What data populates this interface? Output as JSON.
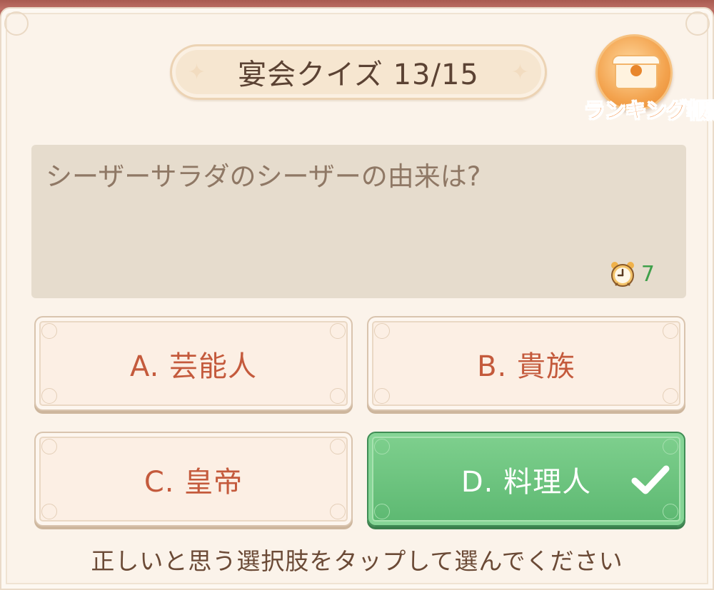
{
  "header": {
    "title": "宴会クイズ 13/15"
  },
  "ranking": {
    "label": "ランキング報酬",
    "icon": "treasure-chest-icon"
  },
  "question": {
    "text": "シーザーサラダのシーザーの由来は?",
    "timer_icon": "alarm-clock-icon",
    "timer_value": "7"
  },
  "options": [
    {
      "label": "A. 芸能人",
      "selected": false
    },
    {
      "label": "B. 貴族",
      "selected": false
    },
    {
      "label": "C. 皇帝",
      "selected": false
    },
    {
      "label": "D. 料理人",
      "selected": true
    }
  ],
  "instruction": "正しいと思う選択肢をタップして選んでください",
  "colors": {
    "panel_bg": "#fbf3ea",
    "correct_green": "#5cb871",
    "option_text": "#c45a3c",
    "timer_green": "#3fa04a"
  }
}
